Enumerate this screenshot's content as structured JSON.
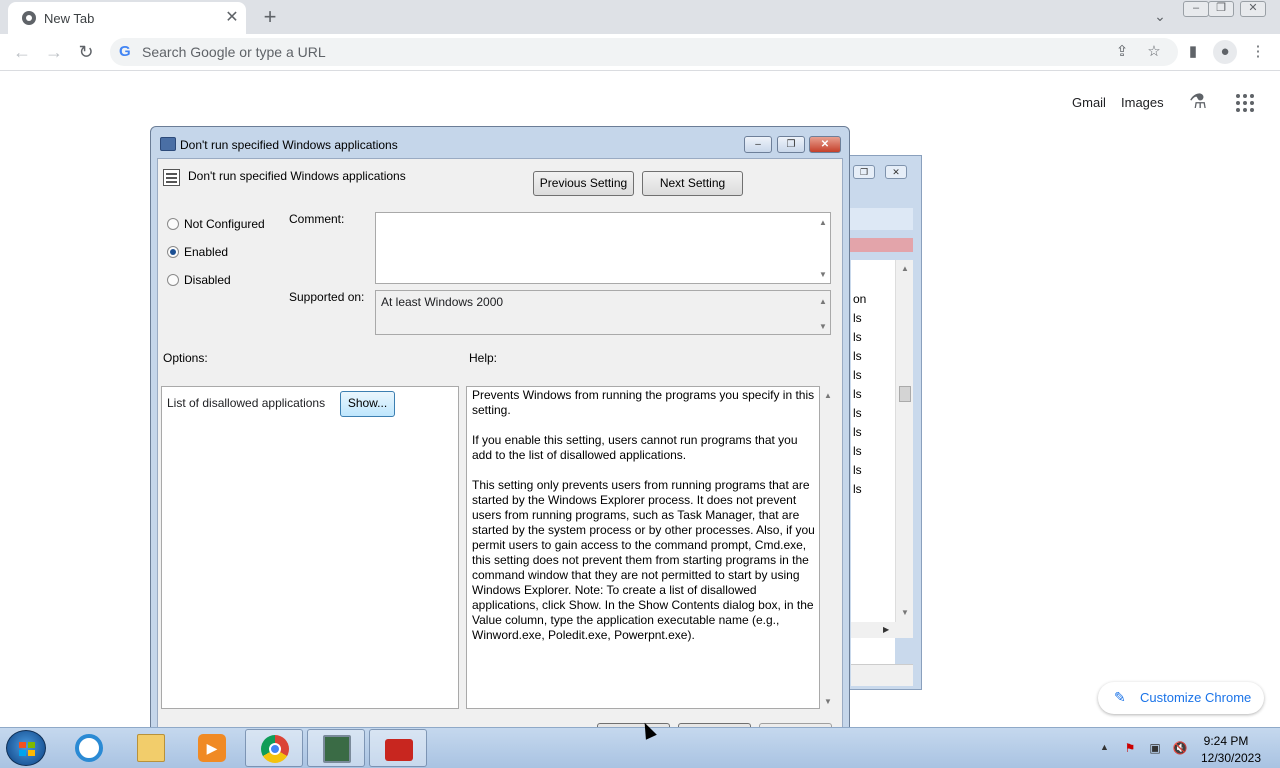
{
  "browser": {
    "tab_title": "New Tab",
    "tab_close": "✕",
    "new_tab": "+",
    "omnibox_placeholder": "Search Google or type a URL",
    "ntp_links": {
      "gmail": "Gmail",
      "images": "Images"
    },
    "customize_label": "Customize Chrome"
  },
  "dialog": {
    "window_title": "Don't run specified Windows applications",
    "policy_name": "Don't run specified Windows applications",
    "prev_button": "Previous Setting",
    "next_button": "Next Setting",
    "state_options": [
      "Not Configured",
      "Enabled",
      "Disabled"
    ],
    "selected_state": "Enabled",
    "comment_label": "Comment:",
    "comment_value": "",
    "supported_label": "Supported on:",
    "supported_value": "At least Windows 2000",
    "options_label": "Options:",
    "help_label": "Help:",
    "option_item_label": "List of disallowed applications",
    "show_button": "Show...",
    "help_paragraphs": [
      "Prevents Windows from running the programs you specify in this setting.",
      "If you enable this setting, users cannot run programs that you add to the list of disallowed applications.",
      "This setting only prevents users from running programs that are started by the Windows Explorer process. It does not prevent users from running programs, such as Task Manager, that are started by the system process or by other processes. Also, if you permit users to gain access to the command prompt, Cmd.exe, this setting does not prevent them from starting programs in the command window that they are not permitted to start by using Windows Explorer. Note: To create a list of disallowed applications, click Show. In the Show Contents dialog box, in the Value column, type the application executable name (e.g., Winword.exe, Poledit.exe, Powerpnt.exe)."
    ]
  },
  "background_window": {
    "row_fragments": [
      "on",
      "ls",
      "ls",
      "ls",
      "ls",
      "ls",
      "ls",
      "ls",
      "ls",
      "ls",
      "ls"
    ]
  },
  "taskbar": {
    "apps": [
      "internet-explorer",
      "file-explorer",
      "media-player",
      "chrome",
      "system-tool",
      "toolbox"
    ],
    "clock_time": "9:24 PM",
    "clock_date": "12/30/2023"
  },
  "colors": {
    "dialog_frame": "#c5d6ea",
    "dialog_body": "#f0f0f0",
    "chrome_tabstrip": "#dee1e6",
    "accent_blue": "#1a73e8"
  }
}
